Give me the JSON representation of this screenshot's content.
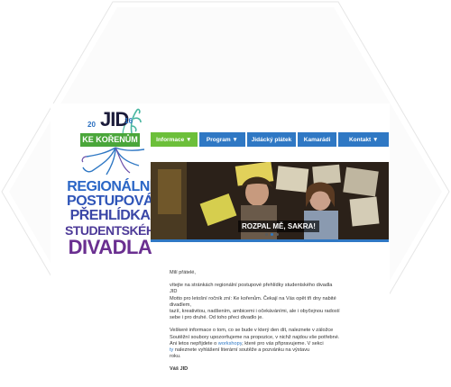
{
  "logo": {
    "jid": "JID",
    "year_left": "20",
    "year_right": "16",
    "subtitle": "KE KOŘENŮM"
  },
  "headline": [
    "REGIONÁLNÍ",
    "POSTUPOVÁ",
    "PŘEHLÍDKA",
    "STUDENTSKÉHO",
    "DIVADLA"
  ],
  "nav": [
    {
      "label": "Informace ▼",
      "active": true
    },
    {
      "label": "Program ▼",
      "active": false
    },
    {
      "label": "Jidácký plátek",
      "active": false
    },
    {
      "label": "Kamarádi",
      "active": false
    },
    {
      "label": "Kontakt ▼",
      "active": false
    }
  ],
  "banner": {
    "caption": "ROZPAL MĚ, SAKRA!",
    "slides": 3,
    "active_slide": 2
  },
  "content": {
    "greeting": "Milí přátelé,",
    "p1": "vítejte na stránkách regionální postupové přehlídky studentského divadla JID\nMotto pro letošní ročník zní: Ke kořenům. Čekají na Vás opět tři dny nabité divadlem,\ntazíí, kreativitou, nadšením, ambicemi i očekáváními, ale i obyčejnou radostí\nsebe i pro druhé. Od toho přeci divadlo je.",
    "p2a": "Veškeré informace o tom, co se bude v který den dít, naleznete v záložce\nSoutěžní soubory upozorňujeme na propozice, v nichž najdou vše potřebné.\nAni letos nepřijdete o ",
    "p2_link": "workshopy",
    "p2b": ", které pro vás připravujeme. V sekci",
    "p2c_link": "ty",
    "p2c": " naleznete vyhlášení literární soutěže a pozvánku na výstavu\nroku.",
    "signature": "Váš JID"
  },
  "colors": {
    "nav_active": "#6cbf3a",
    "nav_blue": "#2f78c4",
    "logo_green": "#4aa63a"
  }
}
